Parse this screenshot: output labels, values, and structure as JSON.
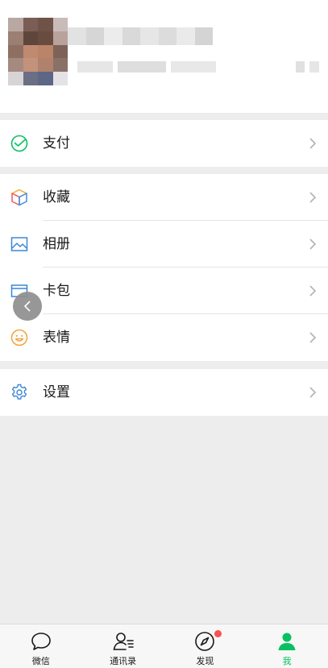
{
  "profile": {
    "name": "",
    "wechat_id": ""
  },
  "menu": {
    "pay": "支付",
    "favorites": "收藏",
    "album": "相册",
    "cards": "卡包",
    "stickers": "表情",
    "settings": "设置"
  },
  "tabs": [
    {
      "label": "微信",
      "icon": "chat-bubble-icon"
    },
    {
      "label": "通讯录",
      "icon": "contacts-icon"
    },
    {
      "label": "发现",
      "icon": "compass-icon",
      "badge": true
    },
    {
      "label": "我",
      "icon": "person-icon",
      "active": true
    }
  ],
  "colors": {
    "accent": "#07c160",
    "badge": "#fa5151",
    "background": "#ededed"
  }
}
